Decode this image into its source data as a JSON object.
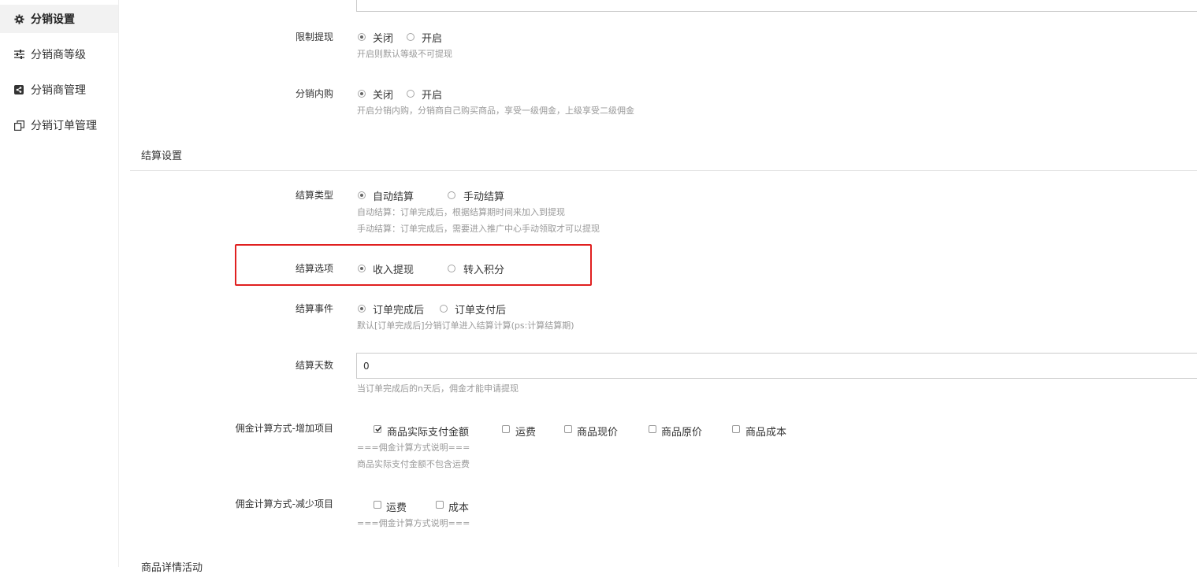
{
  "sidebar": {
    "items": [
      {
        "label": "分销设置",
        "icon": "gear-icon"
      },
      {
        "label": "分销商等级",
        "icon": "sliders-icon"
      },
      {
        "label": "分销商管理",
        "icon": "share-icon"
      },
      {
        "label": "分销订单管理",
        "icon": "copy-icon"
      }
    ]
  },
  "form": {
    "limit_withdraw": {
      "label": "限制提现",
      "options": [
        "关闭",
        "开启"
      ],
      "selected": "关闭",
      "hint": "开启则默认等级不可提现"
    },
    "internal_purchase": {
      "label": "分销内购",
      "options": [
        "关闭",
        "开启"
      ],
      "selected": "关闭",
      "hint": "开启分销内购，分销商自己购买商品，享受一级佣金，上级享受二级佣金"
    },
    "settlement_section_title": "结算设置",
    "settlement_type": {
      "label": "结算类型",
      "options": [
        "自动结算",
        "手动结算"
      ],
      "selected": "自动结算",
      "hint1": "自动结算：订单完成后，根据结算期时间来加入到提现",
      "hint2": "手动结算：订单完成后，需要进入推广中心手动领取才可以提现"
    },
    "settlement_option": {
      "label": "结算选项",
      "options": [
        "收入提现",
        "转入积分"
      ],
      "selected": "收入提现"
    },
    "settlement_event": {
      "label": "结算事件",
      "options": [
        "订单完成后",
        "订单支付后"
      ],
      "selected": "订单完成后",
      "hint": "默认[订单完成后]分销订单进入结算计算(ps:计算结算期)"
    },
    "settlement_days": {
      "label": "结算天数",
      "value": "0",
      "hint": "当订单完成后的n天后，佣金才能申请提现"
    },
    "commission_add": {
      "label": "佣金计算方式-增加项目",
      "options": [
        "商品实际支付金额",
        "运费",
        "商品现价",
        "商品原价",
        "商品成本"
      ],
      "checked": [
        "商品实际支付金额"
      ],
      "hint1": "===佣金计算方式说明===",
      "hint2": "商品实际支付金额不包含运费"
    },
    "commission_reduce": {
      "label": "佣金计算方式-减少项目",
      "options": [
        "运费",
        "成本"
      ],
      "checked": [],
      "hint1": "===佣金计算方式说明==="
    },
    "next_section_title": "商品详情活动"
  },
  "colors": {
    "highlight_border": "#e02020",
    "active_bg": "#f2f2f2"
  }
}
